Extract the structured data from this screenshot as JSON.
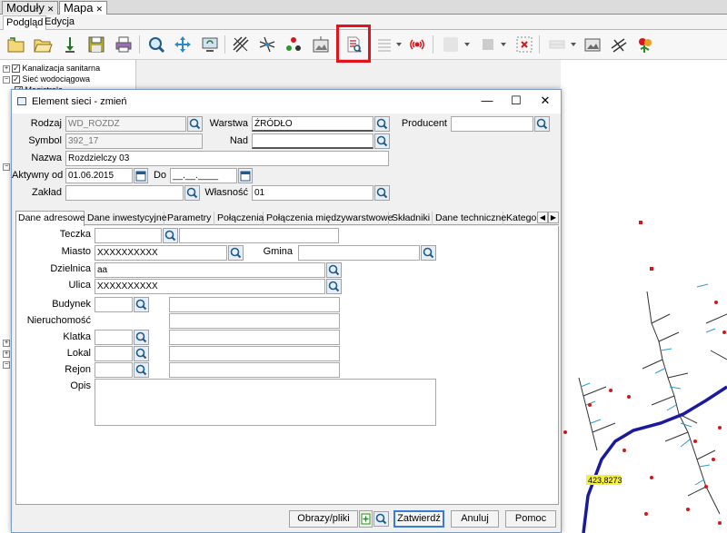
{
  "doc_tabs": [
    {
      "label": "Moduły",
      "active": false
    },
    {
      "label": "Mapa",
      "active": true
    }
  ],
  "ribbon_tabs": [
    {
      "label": "Podgląd",
      "active": true
    },
    {
      "label": "Edycja",
      "active": false
    }
  ],
  "tree": {
    "items": [
      {
        "label": "Kanalizacja sanitarna"
      },
      {
        "label": "Sieć wodociągowa"
      },
      {
        "label": "Magistrale"
      }
    ]
  },
  "dialog": {
    "title": "Element sieci - zmień",
    "rodzaj_label": "Rodzaj",
    "rodzaj_value": "WD_ROZDZ",
    "warstwa_label": "Warstwa",
    "warstwa_value": "ŹRÓDŁO",
    "producent_label": "Producent",
    "producent_value": "",
    "symbol_label": "Symbol",
    "symbol_value": "392_17",
    "nad_label": "Nad",
    "nad_value": "",
    "nazwa_label": "Nazwa",
    "nazwa_value": "Rozdzielczy 03",
    "aktywny_od_label": "Aktywny od",
    "aktywny_od_value": "01.06.2015",
    "do_label": "Do",
    "do_value": "__.__.____",
    "zaklad_label": "Zakład",
    "zaklad_value": "",
    "wlasnosc_label": "Własność",
    "wlasnosc_value": "01",
    "tabs": [
      {
        "label": "Dane adresowe",
        "active": true
      },
      {
        "label": "Dane inwestycyjne"
      },
      {
        "label": "Parametry"
      },
      {
        "label": "Połączenia"
      },
      {
        "label": "Połączenia międzywarstwowe"
      },
      {
        "label": "Składniki"
      },
      {
        "label": "Dane techniczne"
      },
      {
        "label": "Kategor"
      }
    ],
    "address": {
      "teczka_label": "Teczka",
      "teczka_value": "",
      "miasto_label": "Miasto",
      "miasto_value": "XXXXXXXXXX",
      "gmina_label": "Gmina",
      "gmina_value": "",
      "dzielnica_label": "Dzielnica",
      "dzielnica_value": "aa",
      "ulica_label": "Ulica",
      "ulica_value": "XXXXXXXXXX",
      "budynek_label": "Budynek",
      "nieruchomosc_label": "Nieruchomość",
      "klatka_label": "Klatka",
      "lokal_label": "Lokal",
      "rejon_label": "Rejon",
      "opis_label": "Opis",
      "opis_value": ""
    },
    "buttons": {
      "obrazy": "Obrazy/pliki",
      "zatwierdz": "Zatwierdź",
      "anuluj": "Anuluj",
      "pomoc": "Pomoc"
    }
  },
  "map": {
    "label": "423,8273"
  },
  "colors": {
    "highlight": "#e3121c",
    "pipe_main": "#1a1aa0",
    "pipe_branch": "#2b9ad8",
    "node": "#d8141c"
  }
}
